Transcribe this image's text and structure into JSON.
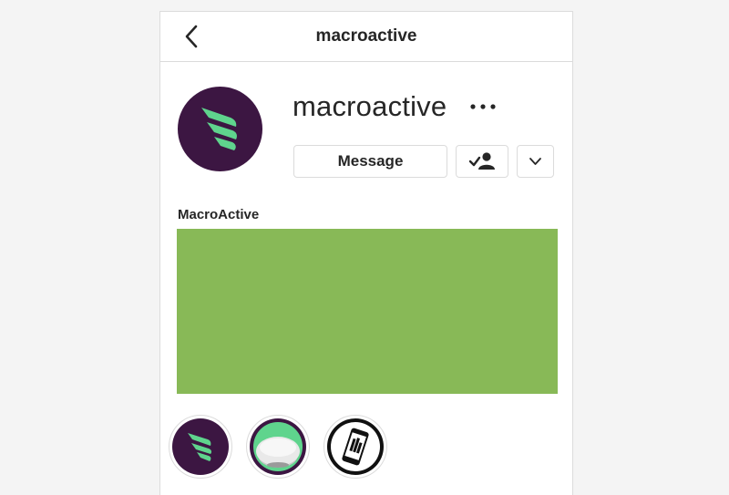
{
  "header": {
    "title": "macroactive",
    "back_icon": "chevron-left-icon"
  },
  "profile": {
    "username": "macroactive",
    "avatar_icon": "macroactive-wing-logo",
    "avatar_color": "#3c1642",
    "logo_color": "#5fd48d",
    "more_icon": "ellipsis-icon",
    "message_label": "Message",
    "following_icon": "user-check-icon",
    "dropdown_icon": "chevron-down-icon"
  },
  "bio": {
    "name": "MacroActive"
  },
  "banner": {
    "color": "#88b957"
  },
  "highlights": [
    {
      "icon": "macroactive-wing-logo"
    },
    {
      "icon": "device-icon"
    },
    {
      "icon": "phone-icon"
    }
  ]
}
